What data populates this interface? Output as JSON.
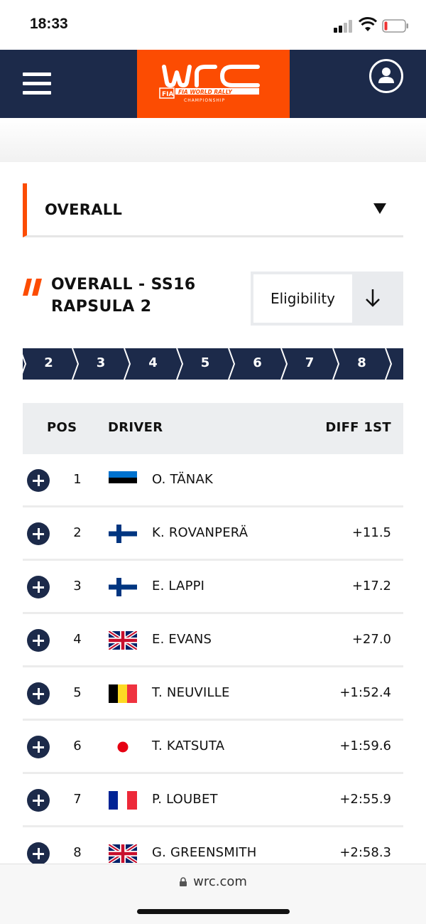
{
  "status_bar": {
    "time": "18:33"
  },
  "header": {
    "logo_text": "WRC",
    "logo_tagline": "FIA WORLD RALLY CHAMPIONSHIP"
  },
  "dropdown": {
    "selected": "OVERALL"
  },
  "title": {
    "line1": "OVERALL - SS16",
    "line2": "RAPSULA 2"
  },
  "eligibility": {
    "label": "Eligibility"
  },
  "stages": [
    "2",
    "3",
    "4",
    "5",
    "6",
    "7",
    "8"
  ],
  "table": {
    "headers": {
      "pos": "POS",
      "driver": "DRIVER",
      "diff": "DIFF 1ST"
    },
    "rows": [
      {
        "pos": "1",
        "flag": "EST",
        "driver": "O. TÄNAK",
        "diff": ""
      },
      {
        "pos": "2",
        "flag": "FIN",
        "driver": "K. ROVANPERÄ",
        "diff": "+11.5"
      },
      {
        "pos": "3",
        "flag": "FIN",
        "driver": "E. LAPPI",
        "diff": "+17.2"
      },
      {
        "pos": "4",
        "flag": "GBR",
        "driver": "E. EVANS",
        "diff": "+27.0"
      },
      {
        "pos": "5",
        "flag": "BEL",
        "driver": "T. NEUVILLE",
        "diff": "+1:52.4"
      },
      {
        "pos": "6",
        "flag": "JPN",
        "driver": "T. KATSUTA",
        "diff": "+1:59.6"
      },
      {
        "pos": "7",
        "flag": "FRA",
        "driver": "P. LOUBET",
        "diff": "+2:55.9"
      },
      {
        "pos": "8",
        "flag": "GBR",
        "driver": "G. GREENSMITH",
        "diff": "+2:58.3"
      }
    ]
  },
  "browser": {
    "url": "wrc.com"
  },
  "colors": {
    "navy": "#1c2a4a",
    "orange": "#fc4c02"
  }
}
